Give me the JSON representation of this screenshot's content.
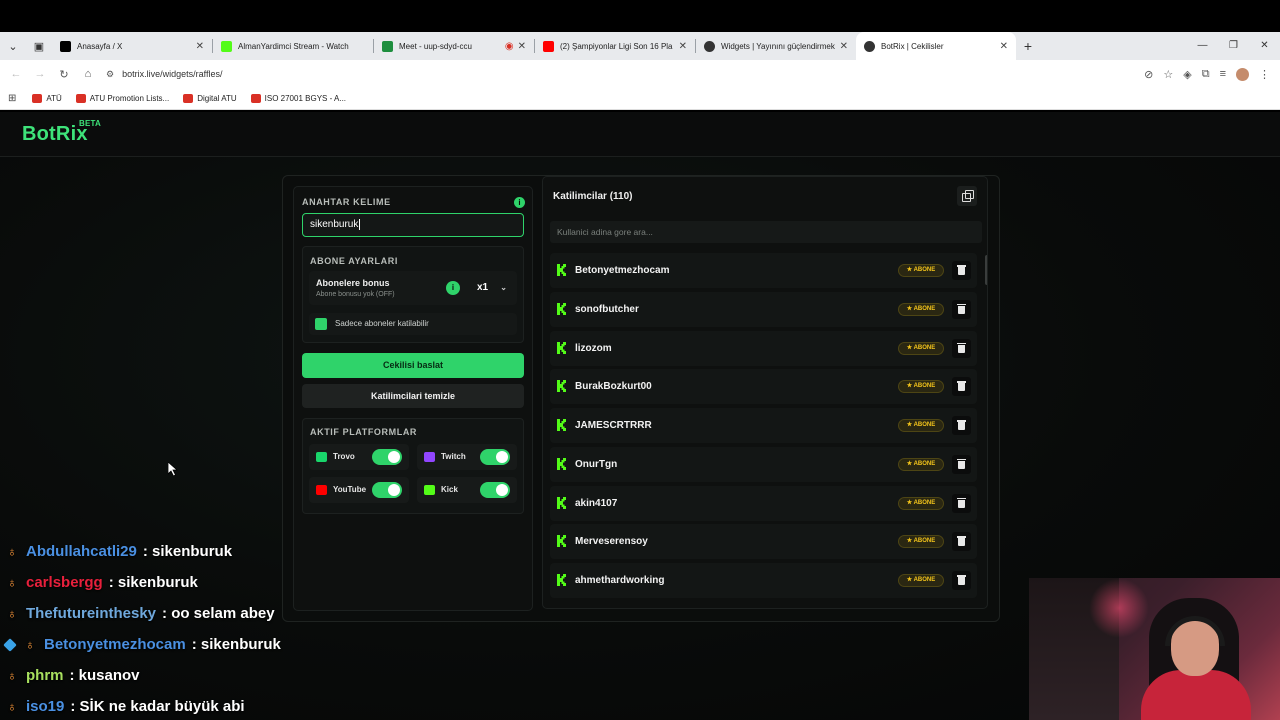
{
  "browser": {
    "tabs": [
      {
        "title": "Anasayfa / X",
        "favicon_color": "#000000"
      },
      {
        "title": "AlmanYardimci Stream - Watch",
        "favicon_color": "#53fc18"
      },
      {
        "title": "Meet - uup-sdyd-ccu",
        "favicon_color": "#00897b"
      },
      {
        "title": "(2) Şampiyonlar Ligi Son 16 Pla",
        "favicon_color": "#ff0000"
      },
      {
        "title": "Widgets | Yayınını güçlendirmek",
        "favicon_color": "#222222"
      },
      {
        "title": "BotRix | Cekilisler",
        "favicon_color": "#222222"
      }
    ],
    "url": "botrix.live/widgets/raffles/",
    "bookmarks": [
      "ATÜ",
      "ATU Promotion Lists...",
      "Digital ATU",
      "ISO 27001 BGYS - A..."
    ]
  },
  "site": {
    "logo": "BotRix",
    "logo_tag": "BETA",
    "accent_color": "#2fd36a"
  },
  "raffle": {
    "keyword_title": "ANAHTAR KELIME",
    "keyword_value": "sikenburuk",
    "sub_settings_title": "ABONE AYARLARI",
    "bonus_label": "Abonelere bonus",
    "bonus_desc": "Abone bonusu yok (OFF)",
    "bonus_multiplier": "x1",
    "only_subs_label": "Sadece aboneler katilabilir",
    "only_subs_checked": true,
    "start_button": "Cekilisi baslat",
    "clear_button": "Katilimcilari temizle",
    "platforms_title": "AKTIF PLATFORMLAR",
    "platforms": [
      {
        "name": "Trovo",
        "enabled": true,
        "icon": "trovo-icon",
        "color": "#19d66b"
      },
      {
        "name": "Twitch",
        "enabled": true,
        "icon": "twitch-icon",
        "color": "#9146ff"
      },
      {
        "name": "YouTube",
        "enabled": true,
        "icon": "youtube-icon",
        "color": "#ff0000"
      },
      {
        "name": "Kick",
        "enabled": true,
        "icon": "kick-icon",
        "color": "#53fc18"
      }
    ]
  },
  "participants": {
    "title": "Katilimcilar (110)",
    "search_placeholder": "Kullanici adina gore ara...",
    "badge_label": "ABONE",
    "items": [
      "Betonyetmezhocam",
      "sonofbutcher",
      "lizozom",
      "BurakBozkurt00",
      "JAMESCRTRRR",
      "OnurTgn",
      "akin4107",
      "Merveserensoy",
      "ahmethardworking"
    ]
  },
  "chat": [
    {
      "user": "Abdullahcatli29",
      "color": "#4a90e2",
      "text": ": sikenburuk",
      "cube": false
    },
    {
      "user": "carlsbergg",
      "color": "#e8203c",
      "text": ": sikenburuk",
      "cube": false
    },
    {
      "user": "Thefutureinthesky",
      "color": "#6fa8dc",
      "text": ": oo selam abey",
      "cube": false
    },
    {
      "user": "Betonyetmezhocam",
      "color": "#4a90e2",
      "text": ": sikenburuk",
      "cube": true
    },
    {
      "user": "phrm",
      "color": "#a8e05f",
      "text": ": kusanov",
      "cube": false
    },
    {
      "user": "iso19",
      "color": "#4a90e2",
      "text": ": SİK ne kadar büyük abi",
      "cube": false
    }
  ]
}
